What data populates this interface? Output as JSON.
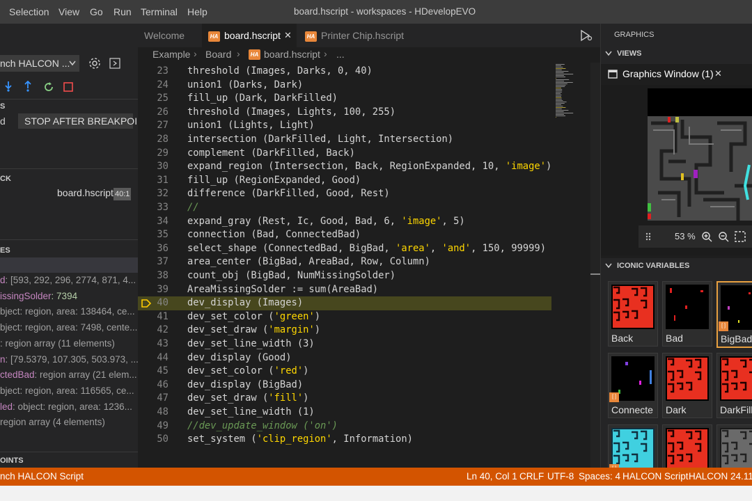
{
  "menu": [
    "Selection",
    "View",
    "Go",
    "Run",
    "Terminal",
    "Help"
  ],
  "window_title": "board.hscript - workspaces - HDevelopEVO",
  "left": {
    "launch_config": "nch HALCON ...",
    "header1": "S",
    "stop_row_left": "d",
    "stop_label": "STOP AFTER BREAKPOINT",
    "callstack_header": "CK",
    "callstack_file": "board.hscript",
    "callstack_pos": "40:1",
    "variables_header": "ES",
    "variables": [
      {
        "name": "d",
        "val": ": [593, 292, 296, 2774, 871, 4..."
      },
      {
        "name": "issingSolder",
        "val": ": 7394",
        "num": true
      },
      {
        "name": "",
        "val": "bject: region, area: 138464, ce..."
      },
      {
        "name": "",
        "val": "bject: region, area: 7498, cente..."
      },
      {
        "name": "",
        "val": ": region array (11 elements)"
      },
      {
        "name": "n",
        "val": ": [79.5379, 107.305, 503.973, ..."
      },
      {
        "name": "ctedBad",
        "val": ": region array (21 elem..."
      },
      {
        "name": "",
        "val": "bject: region, area: 116565, ce..."
      },
      {
        "name": "led",
        "val": ": object: region, area: 1236..."
      },
      {
        "name": "",
        "val": "region array (4 elements)"
      }
    ],
    "breakpoints_header": "OINTS"
  },
  "tabs": [
    {
      "label": "Welcome",
      "icon": false,
      "active": false
    },
    {
      "label": "board.hscript",
      "icon": true,
      "active": true
    },
    {
      "label": "Printer Chip.hscript",
      "icon": true,
      "active": false
    }
  ],
  "icon_text": "HA",
  "close_glyph": "✕",
  "breadcrumb": {
    "c1": "Example",
    "c2": "Board",
    "c3": "board.hscript",
    "c4": "..."
  },
  "editor": {
    "current_line": 40,
    "lines": [
      {
        "n": "23",
        "t": "threshold (Images, Darks, 0, 40)"
      },
      {
        "n": "24",
        "t": "union1 (Darks, Dark)"
      },
      {
        "n": "25",
        "t": "fill_up (Dark, DarkFilled)"
      },
      {
        "n": "26",
        "t": "threshold (Images, Lights, 100, 255)"
      },
      {
        "n": "27",
        "t": "union1 (Lights, Light)"
      },
      {
        "n": "28",
        "t": "intersection (DarkFilled, Light, Intersection)"
      },
      {
        "n": "29",
        "t": "complement (DarkFilled, Back)"
      },
      {
        "n": "30",
        "t": "expand_region (Intersection, Back, RegionExpanded, 10, 'image')"
      },
      {
        "n": "31",
        "t": "fill_up (RegionExpanded, Good)"
      },
      {
        "n": "32",
        "t": "difference (DarkFilled, Good, Rest)"
      },
      {
        "n": "33",
        "t": "//"
      },
      {
        "n": "34",
        "t": "expand_gray (Rest, Ic, Good, Bad, 6, 'image', 5)"
      },
      {
        "n": "35",
        "t": "connection (Bad, ConnectedBad)"
      },
      {
        "n": "36",
        "t": "select_shape (ConnectedBad, BigBad, 'area', 'and', 150, 99999)"
      },
      {
        "n": "37",
        "t": "area_center (BigBad, AreaBad, Row, Column)"
      },
      {
        "n": "38",
        "t": "count_obj (BigBad, NumMissingSolder)"
      },
      {
        "n": "39",
        "t": "AreaMissingSolder := sum(AreaBad)"
      },
      {
        "n": "40",
        "t": "dev_display (Images)"
      },
      {
        "n": "41",
        "t": "dev_set_color ('green')"
      },
      {
        "n": "42",
        "t": "dev_set_draw ('margin')"
      },
      {
        "n": "43",
        "t": "dev_set_line_width (3)"
      },
      {
        "n": "44",
        "t": "dev_display (Good)"
      },
      {
        "n": "45",
        "t": "dev_set_color ('red')"
      },
      {
        "n": "46",
        "t": "dev_display (BigBad)"
      },
      {
        "n": "47",
        "t": "dev_set_draw ('fill')"
      },
      {
        "n": "48",
        "t": "dev_set_line_width (1)"
      },
      {
        "n": "49",
        "t": "//dev_update_window ('on')"
      },
      {
        "n": "50",
        "t": "set_system ('clip_region', Information)"
      }
    ]
  },
  "right": {
    "graphics_header": "GRAPHICS",
    "views_header": "VIEWS",
    "graphics_window_tab": "Graphics Window (1)",
    "zoom": "53 %",
    "iconic_header": "ICONIC VARIABLES",
    "thumbs": [
      {
        "label": "Back",
        "style": "red",
        "badge": false,
        "selected": false
      },
      {
        "label": "Bad",
        "style": "darkred",
        "badge": false,
        "selected": false
      },
      {
        "label": "BigBad",
        "style": "dark",
        "badge": true,
        "selected": true
      },
      {
        "label": "Connecte",
        "style": "dots",
        "badge": true,
        "selected": false
      },
      {
        "label": "Dark",
        "style": "red",
        "badge": false,
        "selected": false
      },
      {
        "label": "DarkFill",
        "style": "red",
        "badge": false,
        "selected": false
      },
      {
        "label": "",
        "style": "cyan",
        "badge": true,
        "selected": false
      },
      {
        "label": "",
        "style": "red",
        "badge": false,
        "selected": false
      },
      {
        "label": "",
        "style": "gray",
        "badge": false,
        "selected": false
      }
    ]
  },
  "status": {
    "left": "nch HALCON Script",
    "ln_col": "Ln 40, Col 1",
    "eol": "CRLF",
    "encoding": "UTF-8",
    "spaces": "Spaces: 4",
    "language": "HALCON Script",
    "version": "HALCON 24.11"
  }
}
